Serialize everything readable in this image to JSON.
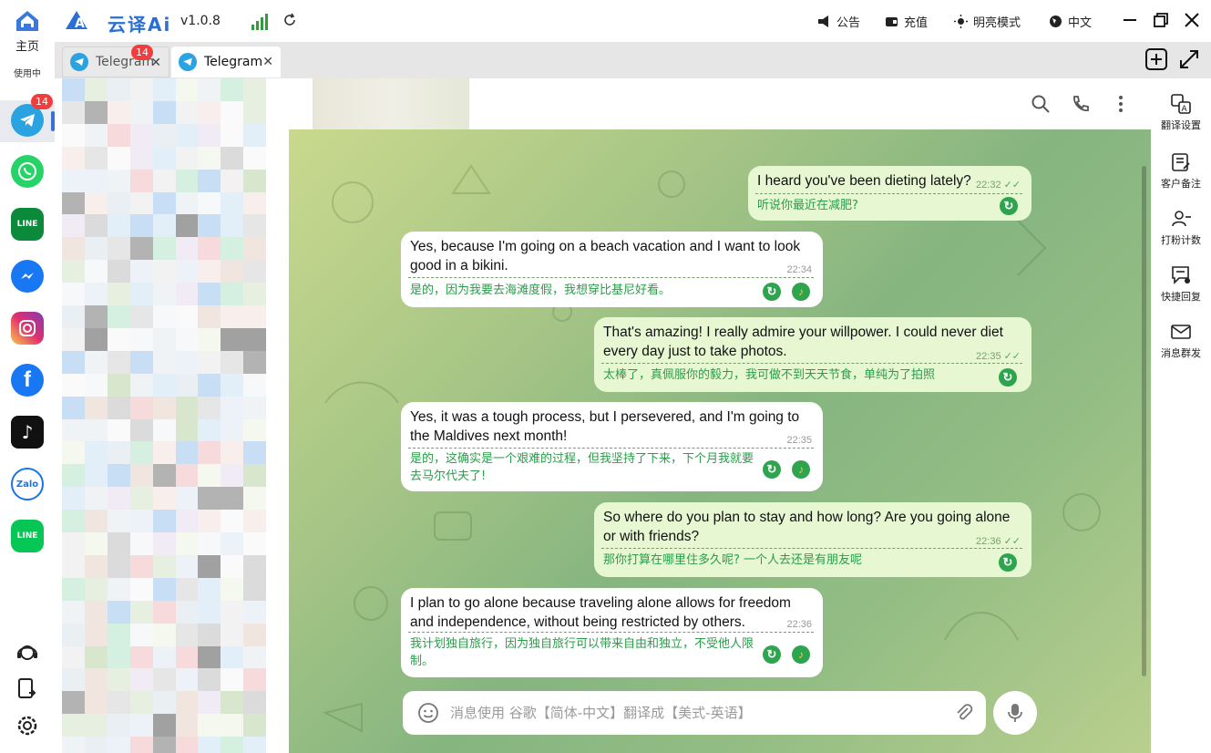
{
  "app": {
    "name": "云译Ai",
    "logo_text": "Ai",
    "version": "v1.0.8"
  },
  "topbar": {
    "announcement": "公告",
    "recharge": "充值",
    "theme": "明亮模式",
    "language": "中文"
  },
  "leftnav": {
    "home_label": "主页",
    "inuse_label": "使用中",
    "telegram_badge": "14",
    "apps": [
      "telegram",
      "whatsapp",
      "line",
      "messenger",
      "instagram",
      "facebook",
      "tiktok",
      "zalo",
      "line-2"
    ],
    "zalo_text": "Zalo",
    "line_text": "LINE"
  },
  "tabs": [
    {
      "label": "Telegram",
      "badge": "14"
    },
    {
      "label": "Telegram"
    }
  ],
  "chat": {
    "messages": [
      {
        "dir": "out",
        "text": "I heard you've been dieting lately?",
        "time": "22:32",
        "translation": "听说你最近在减肥?"
      },
      {
        "dir": "in",
        "text": "Yes, because I'm going on a beach vacation and I want to look good in a bikini.",
        "time": "22:34",
        "translation": "是的，因为我要去海滩度假，我想穿比基尼好看。"
      },
      {
        "dir": "out",
        "text": "That's amazing! I really admire your willpower. I could never diet every day just to take photos.",
        "time": "22:35",
        "translation": "太棒了，真佩服你的毅力，我可做不到天天节食，单纯为了拍照"
      },
      {
        "dir": "in",
        "text": "Yes, it was a tough process, but I persevered, and I'm going to the Maldives next month!",
        "time": "22:35",
        "translation": "是的，这确实是一个艰难的过程，但我坚持了下来，下个月我就要去马尔代夫了!"
      },
      {
        "dir": "out",
        "text": "So where do you plan to stay and how long? Are you going alone or with friends?",
        "time": "22:36",
        "translation": "那你打算在哪里住多久呢? 一个人去还是有朋友呢"
      },
      {
        "dir": "in",
        "text": "I plan to go alone because traveling alone allows for freedom and independence, without being restricted by others.",
        "time": "22:36",
        "translation": "我计划独自旅行，因为独自旅行可以带来自由和独立，不受他人限制。"
      }
    ],
    "input_placeholder": "消息使用 谷歌【简体-中文】翻译成【美式-英语】"
  },
  "righttools": [
    {
      "label": "翻译设置",
      "icon": "translate-settings-icon"
    },
    {
      "label": "客户备注",
      "icon": "customer-notes-icon"
    },
    {
      "label": "打粉计数",
      "icon": "follower-count-icon"
    },
    {
      "label": "快捷回复",
      "icon": "quick-reply-icon"
    },
    {
      "label": "消息群发",
      "icon": "mass-message-icon"
    }
  ],
  "colors": {
    "accent": "#2a6fd6",
    "badge": "#f03e3e",
    "out_bubble": "#e6f7d2",
    "translation_text": "#2a9d4a",
    "telegram": "#2aa3e0"
  }
}
